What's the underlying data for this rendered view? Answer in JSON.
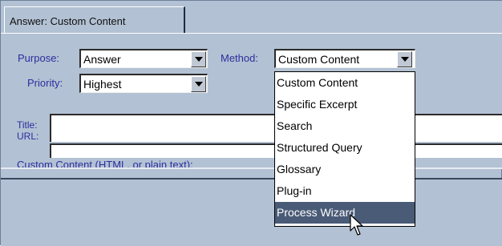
{
  "tab": {
    "label": "Answer: Custom Content"
  },
  "purpose": {
    "label": "Purpose:",
    "value": "Answer"
  },
  "method": {
    "label": "Method:",
    "value": "Custom Content"
  },
  "priority": {
    "label": "Priority:",
    "value": "Highest"
  },
  "title_field": {
    "label": "Title:"
  },
  "url_field": {
    "label": "URL:"
  },
  "custom_content_label": "Custom Content (HTML, or plain text):",
  "method_options": [
    "Custom Content",
    "Specific Excerpt",
    "Search",
    "Structured Query",
    "Glossary",
    "Plug-in",
    "Process Wizard"
  ],
  "method_highlighted_option": "Process Wizard",
  "colors": {
    "panel_bg": "#b2c1d3",
    "label_text": "#2e2e9e",
    "highlight_bg": "#4a5b77"
  },
  "icons": [
    "chevron-down-icon",
    "mouse-pointer-icon"
  ]
}
